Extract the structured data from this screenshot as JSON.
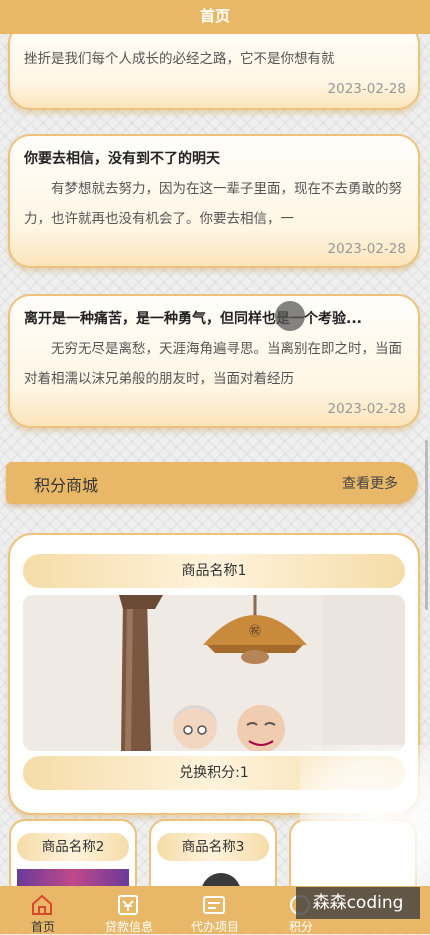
{
  "header": {
    "title": "首页"
  },
  "articles": [
    {
      "excerpt": "挫折是我们每个人成长的必经之路，它不是你想有就",
      "date": "2023-02-28"
    },
    {
      "title": "你要去相信，没有到不了的明天",
      "excerpt": "有梦想就去努力，因为在这一辈子里面，现在不去勇敢的努力，也许就再也没有机会了。你要去相信，一",
      "date": "2023-02-28"
    },
    {
      "title": "离开是一种痛苦，是一种勇气，但同样也是一个考验...",
      "excerpt": "无穷无尽是离愁，天涯海角遍寻思。当离别在即之时，当面对着相濡以沫兄弟般的朋友时，当面对着经历",
      "date": "2023-02-28"
    }
  ],
  "points_mall": {
    "title": "积分商城",
    "more": "查看更多"
  },
  "products": [
    {
      "name": "商品名称1",
      "points": "兑换积分:1"
    },
    {
      "name": "商品名称2"
    },
    {
      "name": "商品名称3"
    }
  ],
  "tabs": [
    {
      "label": "首页",
      "icon": "home-icon"
    },
    {
      "label": "贷款信息",
      "icon": "loan-icon"
    },
    {
      "label": "代办项目",
      "icon": "task-icon"
    },
    {
      "label": "积分",
      "icon": "points-icon"
    }
  ],
  "watermark": "森森coding",
  "colors": {
    "accent": "#e8b868",
    "active_tab": "#d9482b",
    "border": "#ecc27c"
  }
}
